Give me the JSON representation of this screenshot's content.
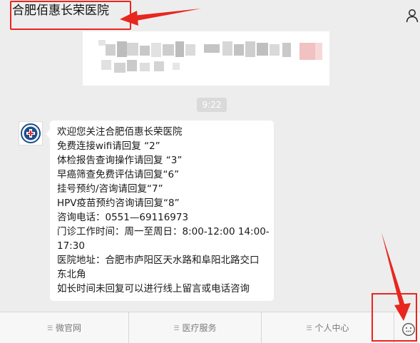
{
  "header": {
    "title": "合肥佰惠长荣医院",
    "profile_icon": "person-icon"
  },
  "chat": {
    "time": "9:22",
    "message_lines": [
      "欢迎您关注合肥佰惠长荣医院",
      "免费连接wifi请回复 “2”",
      "体检报告查询操作请回复 “3”",
      "早癌筛查免费评估请回复“6”",
      "挂号预约/咨询请回复“7”",
      "HPV疫苗预约咨询请回复“8”",
      "咨询电话：0551—69116973",
      "门诊工作时间：周一至周日：8:00-12:00 14:00-",
      "17:30",
      "医院地址：合肥市庐阳区天水路和阜阳北路交口",
      "东北角",
      "如长时间未回复可以进行线上留言或电话咨询"
    ]
  },
  "bottom_menu": {
    "items": [
      {
        "label": "微官网"
      },
      {
        "label": "医疗服务"
      },
      {
        "label": "个人中心"
      }
    ],
    "menu_icon": "menu-lines-icon",
    "emoji_icon": "emoji-icon"
  },
  "colors": {
    "background": "#ededed",
    "bubble": "#ffffff",
    "annotation_red": "#e8261e",
    "time_badge": "#dadada"
  }
}
